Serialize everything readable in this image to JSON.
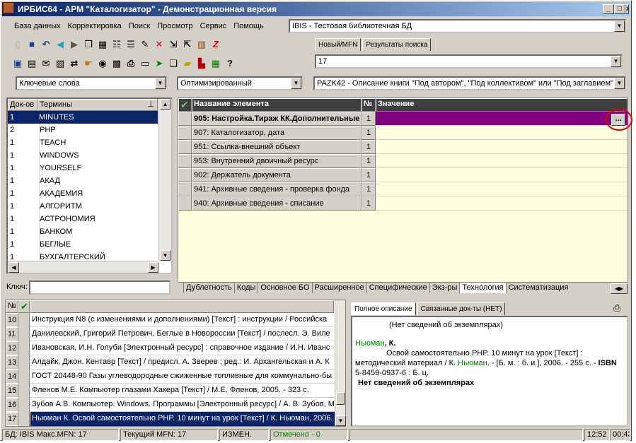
{
  "title": "ИРБИС64 - АРМ \"Каталогизатор\" - Демонстрационная версия",
  "menu": [
    "База данных",
    "Корректировка",
    "Поиск",
    "Просмотр",
    "Сервис",
    "Помощь"
  ],
  "db_combo": "IBIS - Тестовая библиотечная БД",
  "mfn_tabs": [
    "Новый/MFN",
    "Результаты поиска"
  ],
  "mfn_value": "17",
  "dict_combo": "Ключевые слова",
  "opt_combo": "Оптимизированный",
  "ws_combo": "PAZK42 - Описание книги \"Под автором\", \"Под коллективом\" или \"Под заглавием\"",
  "terms_hdr": {
    "docs": "Док-ов",
    "terms": "Термины"
  },
  "terms": [
    {
      "n": "1",
      "t": "MINUTES"
    },
    {
      "n": "2",
      "t": "PHP"
    },
    {
      "n": "1",
      "t": "TEACH"
    },
    {
      "n": "1",
      "t": "WINDOWS"
    },
    {
      "n": "1",
      "t": "YOURSELF"
    },
    {
      "n": "1",
      "t": "АКАД"
    },
    {
      "n": "1",
      "t": "АКАДЕМИЯ"
    },
    {
      "n": "1",
      "t": "АЛГОРИТМ"
    },
    {
      "n": "1",
      "t": "АСТРОНОМИЯ"
    },
    {
      "n": "1",
      "t": "БАНКОМ"
    },
    {
      "n": "1",
      "t": "БЕГЛЫЕ"
    },
    {
      "n": "1",
      "t": "БУХГАЛТЕРСКИЙ"
    }
  ],
  "key_label": "Ключ:",
  "ws_hdr": {
    "name": "Название элемента",
    "num": "№",
    "val": "Значение"
  },
  "fields": [
    {
      "name": "905: Настройка.Тираж КК.Дополнительные",
      "n": "1"
    },
    {
      "name": "907: Каталогизатор, дата",
      "n": "1"
    },
    {
      "name": "951: Ссылка-внешний объект",
      "n": "1"
    },
    {
      "name": "953: Внутренний двоичный ресурс",
      "n": "1"
    },
    {
      "name": "902: Держатель документа",
      "n": "1"
    },
    {
      "name": "941: Архивные сведения - проверка фонда",
      "n": "1"
    },
    {
      "name": "940: Архивные сведения - списание",
      "n": "1"
    }
  ],
  "ellipsis": "...",
  "ws_tabs": [
    "Дублетность",
    "Коды",
    "Основное БО",
    "Расширенное",
    "Специфические",
    "Экз-ры",
    "Технология",
    "Систематизация"
  ],
  "list_hdr": "№",
  "docs": [
    {
      "n": "10",
      "t": "Инструкция N8   (с изменениями и дополнениями) [Текст] : инструкции / Российска"
    },
    {
      "n": "11",
      "t": "Данилевский, Григорий Петрович. Беглые в Новороссии [Текст] / послесл. Э. Виле"
    },
    {
      "n": "12",
      "t": "Ивановская, И.Н. Голуби [Электронный ресурс] : справочное издание / И.Н. Иванс"
    },
    {
      "n": "13",
      "t": "Алдайк, Джон. Кентавр [Текст] / предисл. А. Зверев ; ред.: И. Архангельская и А. К"
    },
    {
      "n": "14",
      "t": "ГОСТ 20448-90 Газы углеводородные сжиженные топливные для коммунально-бы"
    },
    {
      "n": "15",
      "t": "Фленов М.Е. Компьютер глазами Хакера [Текст] / М.Е. Фленов, 2005. - 323 с."
    },
    {
      "n": "16",
      "t": "Зубов А.В. Компьютер. Windows. Программы [Электронный ресурс] / А. В. Зубов, М"
    },
    {
      "n": "17",
      "t": "Ньюман К. Освой самостоятельно PHP. 10 минут на урок [Текст] / К. Ньюман, 2006."
    }
  ],
  "desc_tabs": [
    "Полное описание",
    "Связанные док-ты (НЕТ)"
  ],
  "desc": {
    "no_copies": "(Нет сведений об экземплярах)",
    "author_green": "Ньюман",
    "author_rest": ", К.",
    "body1": "Освой самостоятельно PHP. 10 минут на урок [Текст] : методический материал / К. ",
    "body_green": "Ньюман",
    "body2": ". - [Б. м. : б. и.], 2006. - 255 с. - ",
    "isbn": "ISBN",
    "body3": " 5-8459-0937-6 : Б. ц.",
    "bold_line": "Нет сведений об экземплярах"
  },
  "status": {
    "db": "БД: IBIS Макс.MFN: 17",
    "cur": "Текущий MFN: 17",
    "mod": "ИЗМЕН.",
    "marked": "Отмечено - 0",
    "time1": "12:52",
    "time2": "00:43"
  },
  "colors": {
    "title": "#0a246a",
    "selected": "#0a246a",
    "field_selected": "#800080",
    "value_bg": "#ffffe1",
    "green": "#008000",
    "circle": "#e00000"
  }
}
